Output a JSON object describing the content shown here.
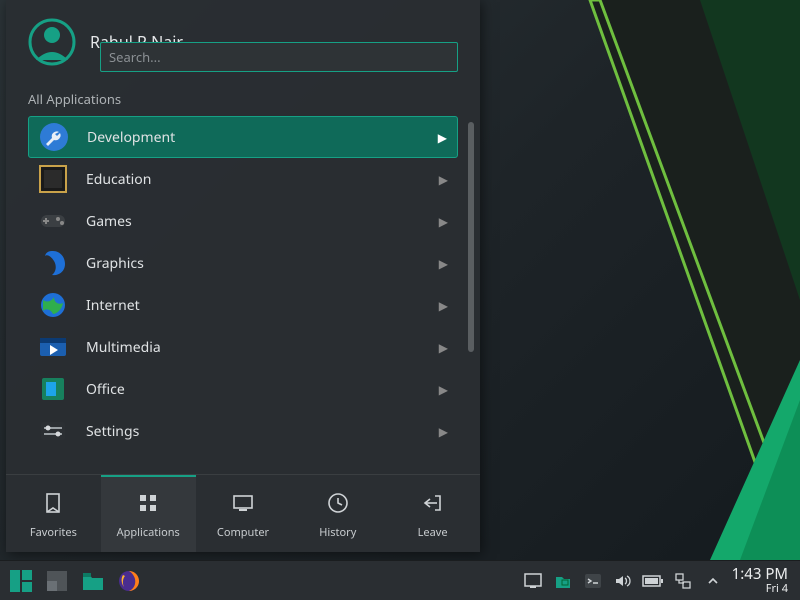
{
  "user": {
    "name": "Rahul R Nair"
  },
  "search": {
    "placeholder": "Search..."
  },
  "section_label": "All Applications",
  "categories": [
    {
      "label": "Development",
      "icon": "wrench",
      "selected": true
    },
    {
      "label": "Education",
      "icon": "education",
      "selected": false
    },
    {
      "label": "Games",
      "icon": "gamepad",
      "selected": false
    },
    {
      "label": "Graphics",
      "icon": "graphics",
      "selected": false
    },
    {
      "label": "Internet",
      "icon": "globe",
      "selected": false
    },
    {
      "label": "Multimedia",
      "icon": "media",
      "selected": false
    },
    {
      "label": "Office",
      "icon": "office",
      "selected": false
    },
    {
      "label": "Settings",
      "icon": "settings",
      "selected": false
    }
  ],
  "tabs": [
    {
      "label": "Favorites",
      "key": "favorites",
      "active": false
    },
    {
      "label": "Applications",
      "key": "applications",
      "active": true
    },
    {
      "label": "Computer",
      "key": "computer",
      "active": false
    },
    {
      "label": "History",
      "key": "history",
      "active": false
    },
    {
      "label": "Leave",
      "key": "leave",
      "active": false
    }
  ],
  "clock": {
    "time": "1:43 PM",
    "date": "Fri 4"
  },
  "accent": "#16a085"
}
